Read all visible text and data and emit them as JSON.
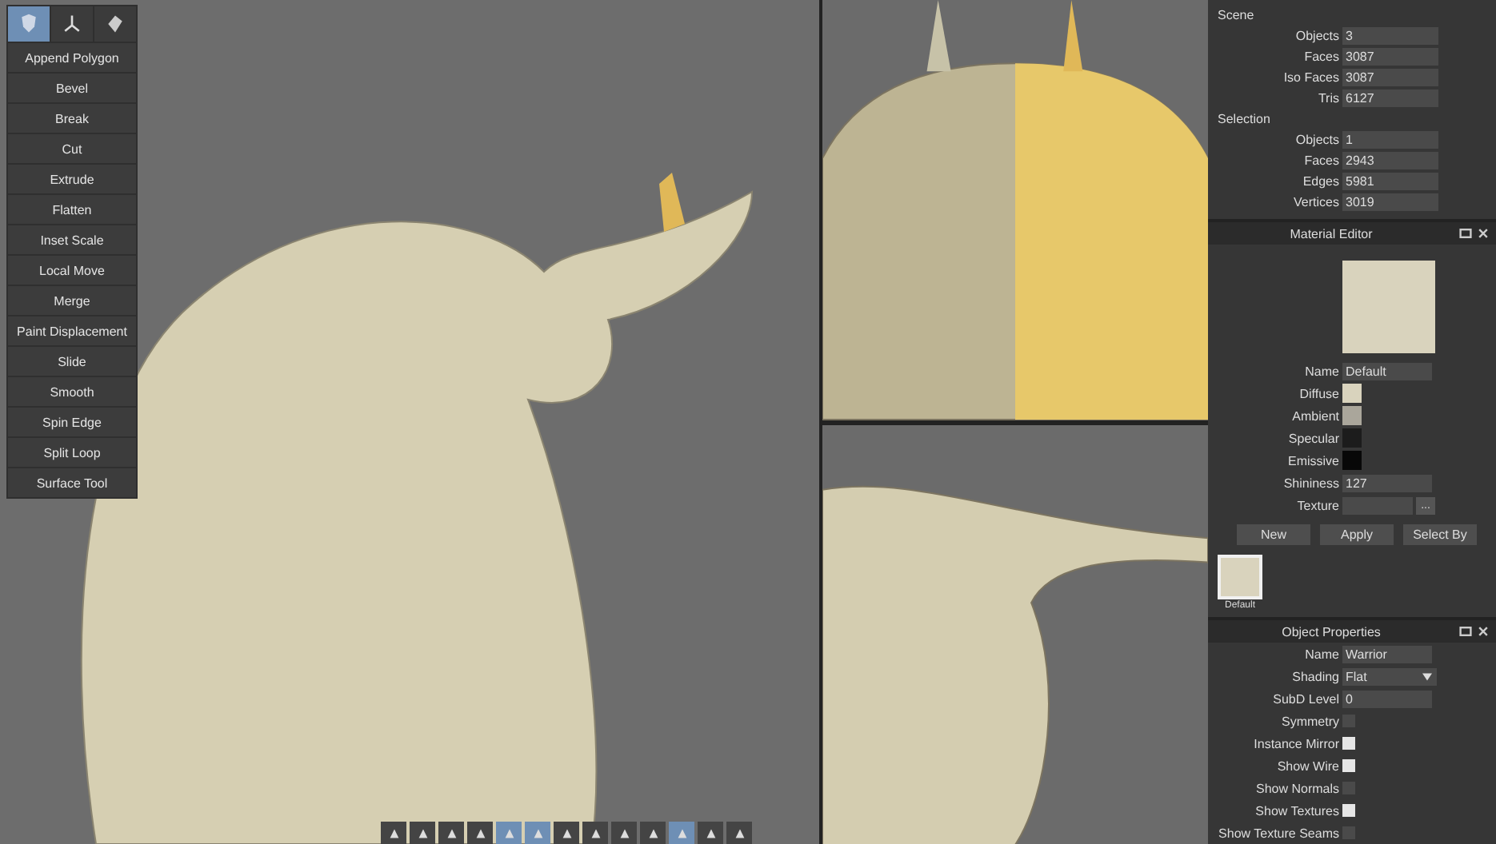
{
  "tool_tabs": [
    {
      "selected": true
    },
    {
      "selected": false
    },
    {
      "selected": false
    }
  ],
  "tools": [
    "Append Polygon",
    "Bevel",
    "Break",
    "Cut",
    "Extrude",
    "Flatten",
    "Inset Scale",
    "Local Move",
    "Merge",
    "Paint Displacement",
    "Slide",
    "Smooth",
    "Spin Edge",
    "Split Loop",
    "Surface Tool"
  ],
  "bottom_toolbar": [
    {
      "selected": false
    },
    {
      "selected": false
    },
    {
      "selected": false
    },
    {
      "selected": false
    },
    {
      "selected": true
    },
    {
      "selected": true
    },
    {
      "selected": false
    },
    {
      "selected": false
    },
    {
      "selected": false
    },
    {
      "selected": false
    },
    {
      "selected": true
    },
    {
      "selected": false
    },
    {
      "selected": false
    }
  ],
  "stats": [
    {
      "title": "Scene",
      "rows": [
        {
          "label": "Objects",
          "value": "3"
        },
        {
          "label": "Faces",
          "value": "3087"
        },
        {
          "label": "Iso Faces",
          "value": "3087"
        },
        {
          "label": "Tris",
          "value": "6127"
        }
      ]
    },
    {
      "title": "Selection",
      "rows": [
        {
          "label": "Objects",
          "value": "1"
        },
        {
          "label": "Faces",
          "value": "2943"
        },
        {
          "label": "Edges",
          "value": "5981"
        },
        {
          "label": "Vertices",
          "value": "3019"
        }
      ]
    }
  ],
  "material_editor": {
    "title": "Material Editor",
    "rows": [
      {
        "kind": "field",
        "label": "Name",
        "value": "Default"
      },
      {
        "kind": "color",
        "label": "Diffuse",
        "color": "#d9d3bd"
      },
      {
        "kind": "color",
        "label": "Ambient",
        "color": "#aaa69b"
      },
      {
        "kind": "color",
        "label": "Specular",
        "color": "#1c1c1c"
      },
      {
        "kind": "color",
        "label": "Emissive",
        "color": "#080808"
      },
      {
        "kind": "field",
        "label": "Shininess",
        "value": "127"
      },
      {
        "kind": "file",
        "label": "Texture",
        "button": "..."
      }
    ],
    "buttons": [
      "New",
      "Apply",
      "Select By"
    ],
    "materials": [
      {
        "name": "Default",
        "selected": true
      }
    ]
  },
  "object_properties": {
    "title": "Object Properties",
    "rows": [
      {
        "kind": "field",
        "label": "Name",
        "value": "Warrior"
      },
      {
        "kind": "dropdown",
        "label": "Shading",
        "value": "Flat"
      },
      {
        "kind": "field",
        "label": "SubD Level",
        "value": "0"
      },
      {
        "kind": "checkbox",
        "label": "Symmetry",
        "checked": false
      },
      {
        "kind": "checkbox",
        "label": "Instance Mirror",
        "checked": true
      },
      {
        "kind": "checkbox",
        "label": "Show Wire",
        "checked": true
      },
      {
        "kind": "checkbox",
        "label": "Show Normals",
        "checked": false
      },
      {
        "kind": "checkbox",
        "label": "Show Textures",
        "checked": true
      },
      {
        "kind": "checkbox",
        "label": "Show Texture Seams",
        "checked": false
      }
    ]
  }
}
